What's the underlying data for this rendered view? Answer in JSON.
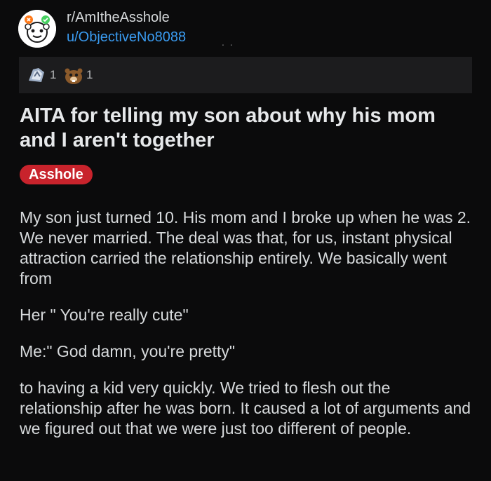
{
  "header": {
    "subreddit": "r/AmItheAsshole",
    "username": "u/ObjectiveNo8088",
    "more_dots": ". ."
  },
  "awards": [
    {
      "icon": "award-badge-icon",
      "count": "1"
    },
    {
      "icon": "gopher-award-icon",
      "count": "1"
    }
  ],
  "post": {
    "title": "AITA for telling my son about why his mom and I aren't together",
    "flair": "Asshole",
    "flair_color": "#c8232c",
    "paragraphs": [
      "My son just turned 10. His mom and I broke up when he was 2. We never married. The deal was that, for us, instant physical attraction carried the relationship entirely. We basically went from",
      "Her \" You're really cute\"",
      "Me:\" God damn, you're pretty\"",
      "to having a kid very quickly. We tried to flesh out the relationship after he was born. It caused a lot of arguments and we figured out that we were just too different of people."
    ]
  }
}
